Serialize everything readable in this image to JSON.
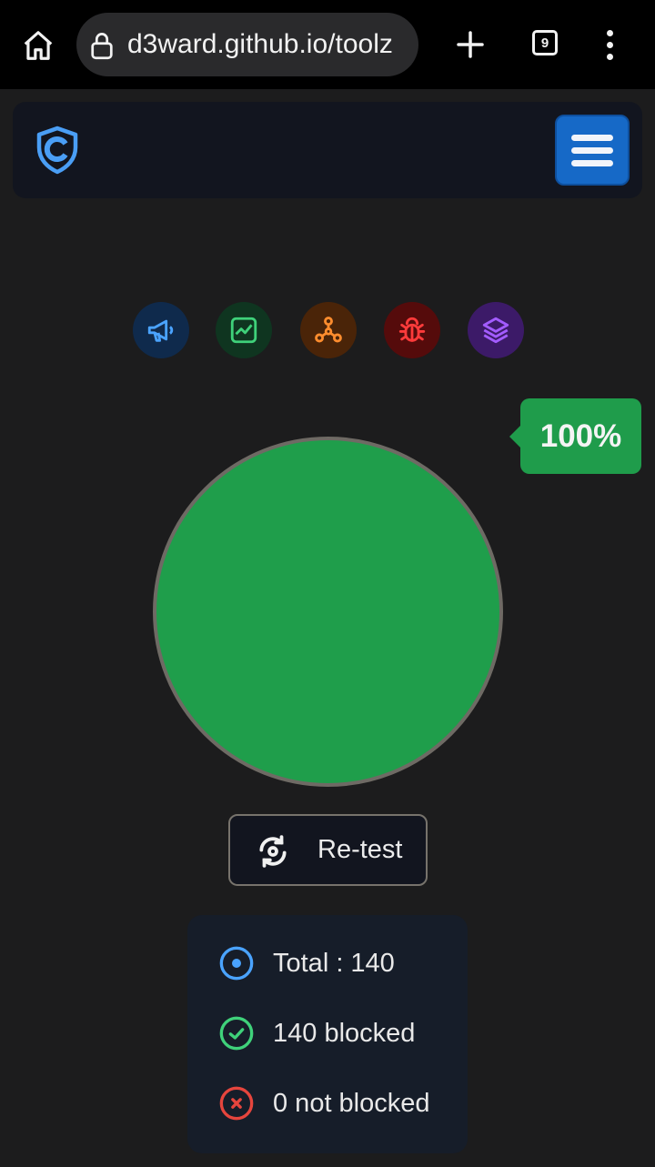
{
  "browser": {
    "url": "d3ward.github.io/toolz",
    "tab_count": "9"
  },
  "header": {
    "logo": "shield-logo"
  },
  "tests": {
    "icons": [
      {
        "name": "ads-icon",
        "color": "#4aa3ff",
        "bg": "#0f2a4c"
      },
      {
        "name": "analytics-icon",
        "color": "#3fd17a",
        "bg": "#0f3520"
      },
      {
        "name": "trackers-icon",
        "color": "#ff8d2e",
        "bg": "#4a2408"
      },
      {
        "name": "error-trackers-icon",
        "color": "#ff3b3b",
        "bg": "#550b0b"
      },
      {
        "name": "mix-icon",
        "color": "#a35cff",
        "bg": "#3c1a68"
      }
    ]
  },
  "result": {
    "percent": "100%",
    "percent_value": 100,
    "circle_color": "#1f9e4b"
  },
  "retest": {
    "label": "Re-test"
  },
  "stats": {
    "total": "Total : 140",
    "blocked": "140 blocked",
    "not_blocked": "0 not blocked"
  },
  "colors": {
    "accent": "#1669c7",
    "success": "#1f9c4b",
    "total": "#4aa3ff",
    "blocked": "#3fd17a",
    "not_blocked": "#e5453d"
  }
}
